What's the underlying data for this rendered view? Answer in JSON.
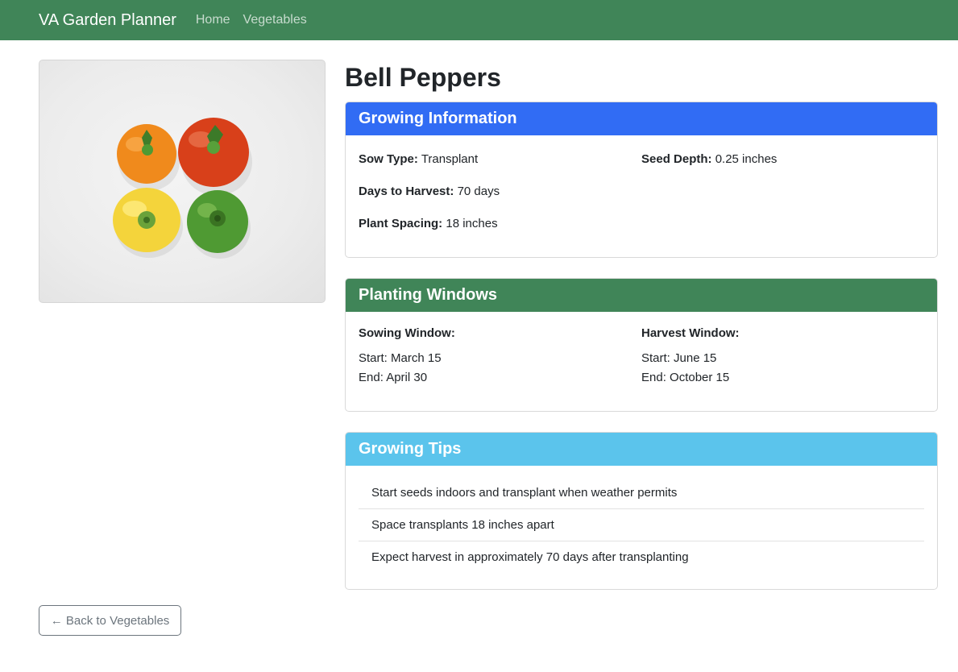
{
  "navbar": {
    "brand": "VA Garden Planner",
    "links": [
      "Home",
      "Vegetables"
    ],
    "bg_color": "#408558"
  },
  "vegetable": {
    "name": "Bell Peppers",
    "image_alt": "four bell peppers: orange, red, yellow, green"
  },
  "growing_info": {
    "title": "Growing Information",
    "header_color": "#316cf4",
    "sow_type_label": "Sow Type:",
    "sow_type": "Transplant",
    "days_label": "Days to Harvest:",
    "days": "70 days",
    "spacing_label": "Plant Spacing:",
    "spacing": "18 inches",
    "depth_label": "Seed Depth:",
    "depth": "0.25 inches"
  },
  "planting_windows": {
    "title": "Planting Windows",
    "header_color": "#408558",
    "sowing": {
      "label": "Sowing Window:",
      "start": "Start: March 15",
      "end": "End: April 30"
    },
    "harvest": {
      "label": "Harvest Window:",
      "start": "Start: June 15",
      "end": "End: October 15"
    }
  },
  "growing_tips": {
    "title": "Growing Tips",
    "header_color": "#5bc4ec",
    "tips": [
      "Start seeds indoors and transplant when weather permits",
      "Space transplants 18 inches apart",
      "Expect harvest in approximately 70 days after transplanting"
    ]
  },
  "back_button": {
    "label": "← Back to Vegetables"
  }
}
